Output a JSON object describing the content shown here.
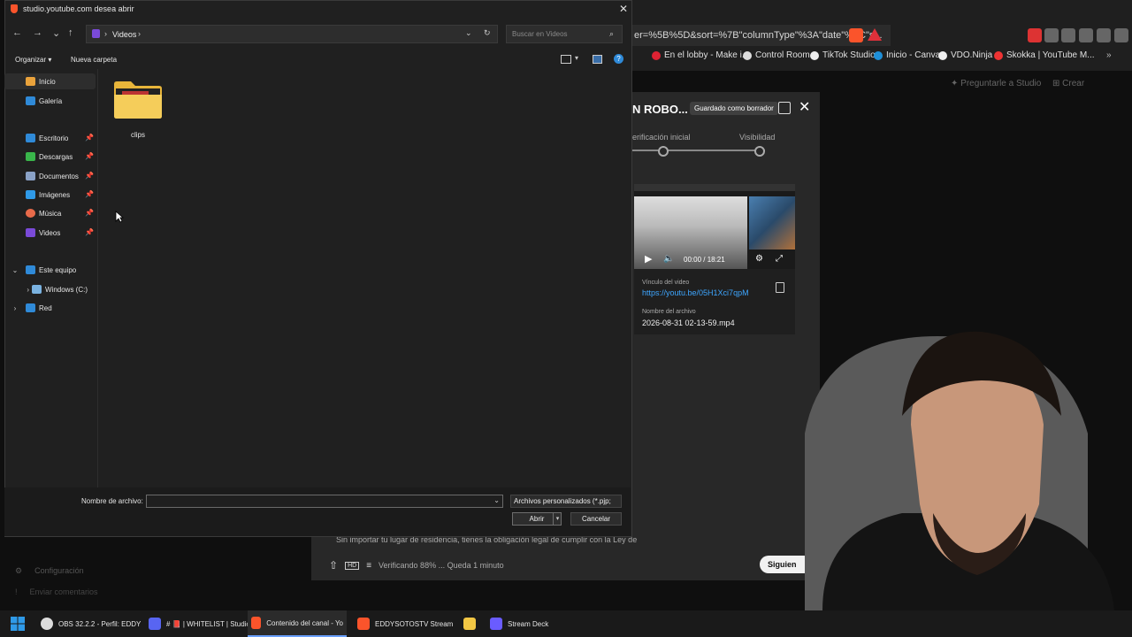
{
  "dialog": {
    "title": "studio.youtube.com desea abrir",
    "breadcrumb": "Videos",
    "search_placeholder": "Buscar en Videos",
    "toolbar": {
      "organize": "Organizar",
      "new_folder": "Nueva carpeta"
    },
    "nav": {
      "home": "Inicio",
      "gallery": "Galería",
      "quick_access": [
        {
          "label": "Escritorio",
          "color": "#2f8ad8"
        },
        {
          "label": "Descargas",
          "color": "#39b54a"
        },
        {
          "label": "Documentos",
          "color": "#8aa2c7"
        },
        {
          "label": "Imágenes",
          "color": "#2f9ae8"
        },
        {
          "label": "Música",
          "color": "#e86a4a"
        },
        {
          "label": "Videos",
          "color": "#7a4ad8"
        }
      ],
      "this_pc": "Este equipo",
      "drive": "Windows (C:)",
      "network": "Red"
    },
    "files": [
      {
        "name": "clips",
        "type": "folder"
      }
    ],
    "footer": {
      "filename_label": "Nombre de archivo:",
      "filename_value": "",
      "filter": "Archivos personalizados (*.pjp;",
      "open": "Abrir",
      "cancel": "Cancelar"
    }
  },
  "browser": {
    "url_fragment": "er=%5B%5D&sort=%7B\"columnType\"%3A\"date\"%2C\"s...",
    "bookmarks": [
      {
        "label": "En el lobby - Make i...",
        "color": "#d23"
      },
      {
        "label": "Control Room",
        "color": "#ddd"
      },
      {
        "label": "TikTok Studio",
        "color": "#eee"
      },
      {
        "label": "Inicio - Canva",
        "color": "#1e8fd8"
      },
      {
        "label": "VDO.Ninja",
        "color": "#eee"
      },
      {
        "label": "Skokka | YouTube M...",
        "color": "#e33"
      }
    ],
    "studio_actions": {
      "ask": "Preguntarle a Studio",
      "create": "Crear"
    }
  },
  "upload": {
    "title": "N ROBO...",
    "draft_badge": "Guardado como borrador",
    "steps": [
      "erificación inicial",
      "Visibilidad"
    ],
    "player_time": "00:00 / 18:21",
    "link_label": "Vínculo del video",
    "link": "https://youtu.be/05H1Xci7qpM",
    "filename_label": "Nombre del archivo",
    "filename": "2026-08-31 02-13-59.mp4",
    "legal": "Sin importar tu lugar de residencia, tienes la obligación legal de cumplir con la Ley de",
    "status": "Verificando 88% ... Queda 1 minuto",
    "next": "Siguien"
  },
  "sidebar": {
    "settings": "Configuración",
    "feedback": "Enviar comentarios"
  },
  "taskbar": {
    "items": [
      {
        "label": "OBS 32.2.2 - Perfil: EDDY",
        "color": "#ddd"
      },
      {
        "label": "# 📕 | WHITELIST | Studio",
        "color": "#5865f2"
      },
      {
        "label": "Contenido del canal - Yo",
        "color": "#fb542b"
      },
      {
        "label": "EDDYSOTOSTV Stream",
        "color": "#fb542b"
      },
      {
        "label": "",
        "color": "#f2c744"
      },
      {
        "label": "Stream Deck",
        "color": "#6a5cff"
      }
    ]
  }
}
